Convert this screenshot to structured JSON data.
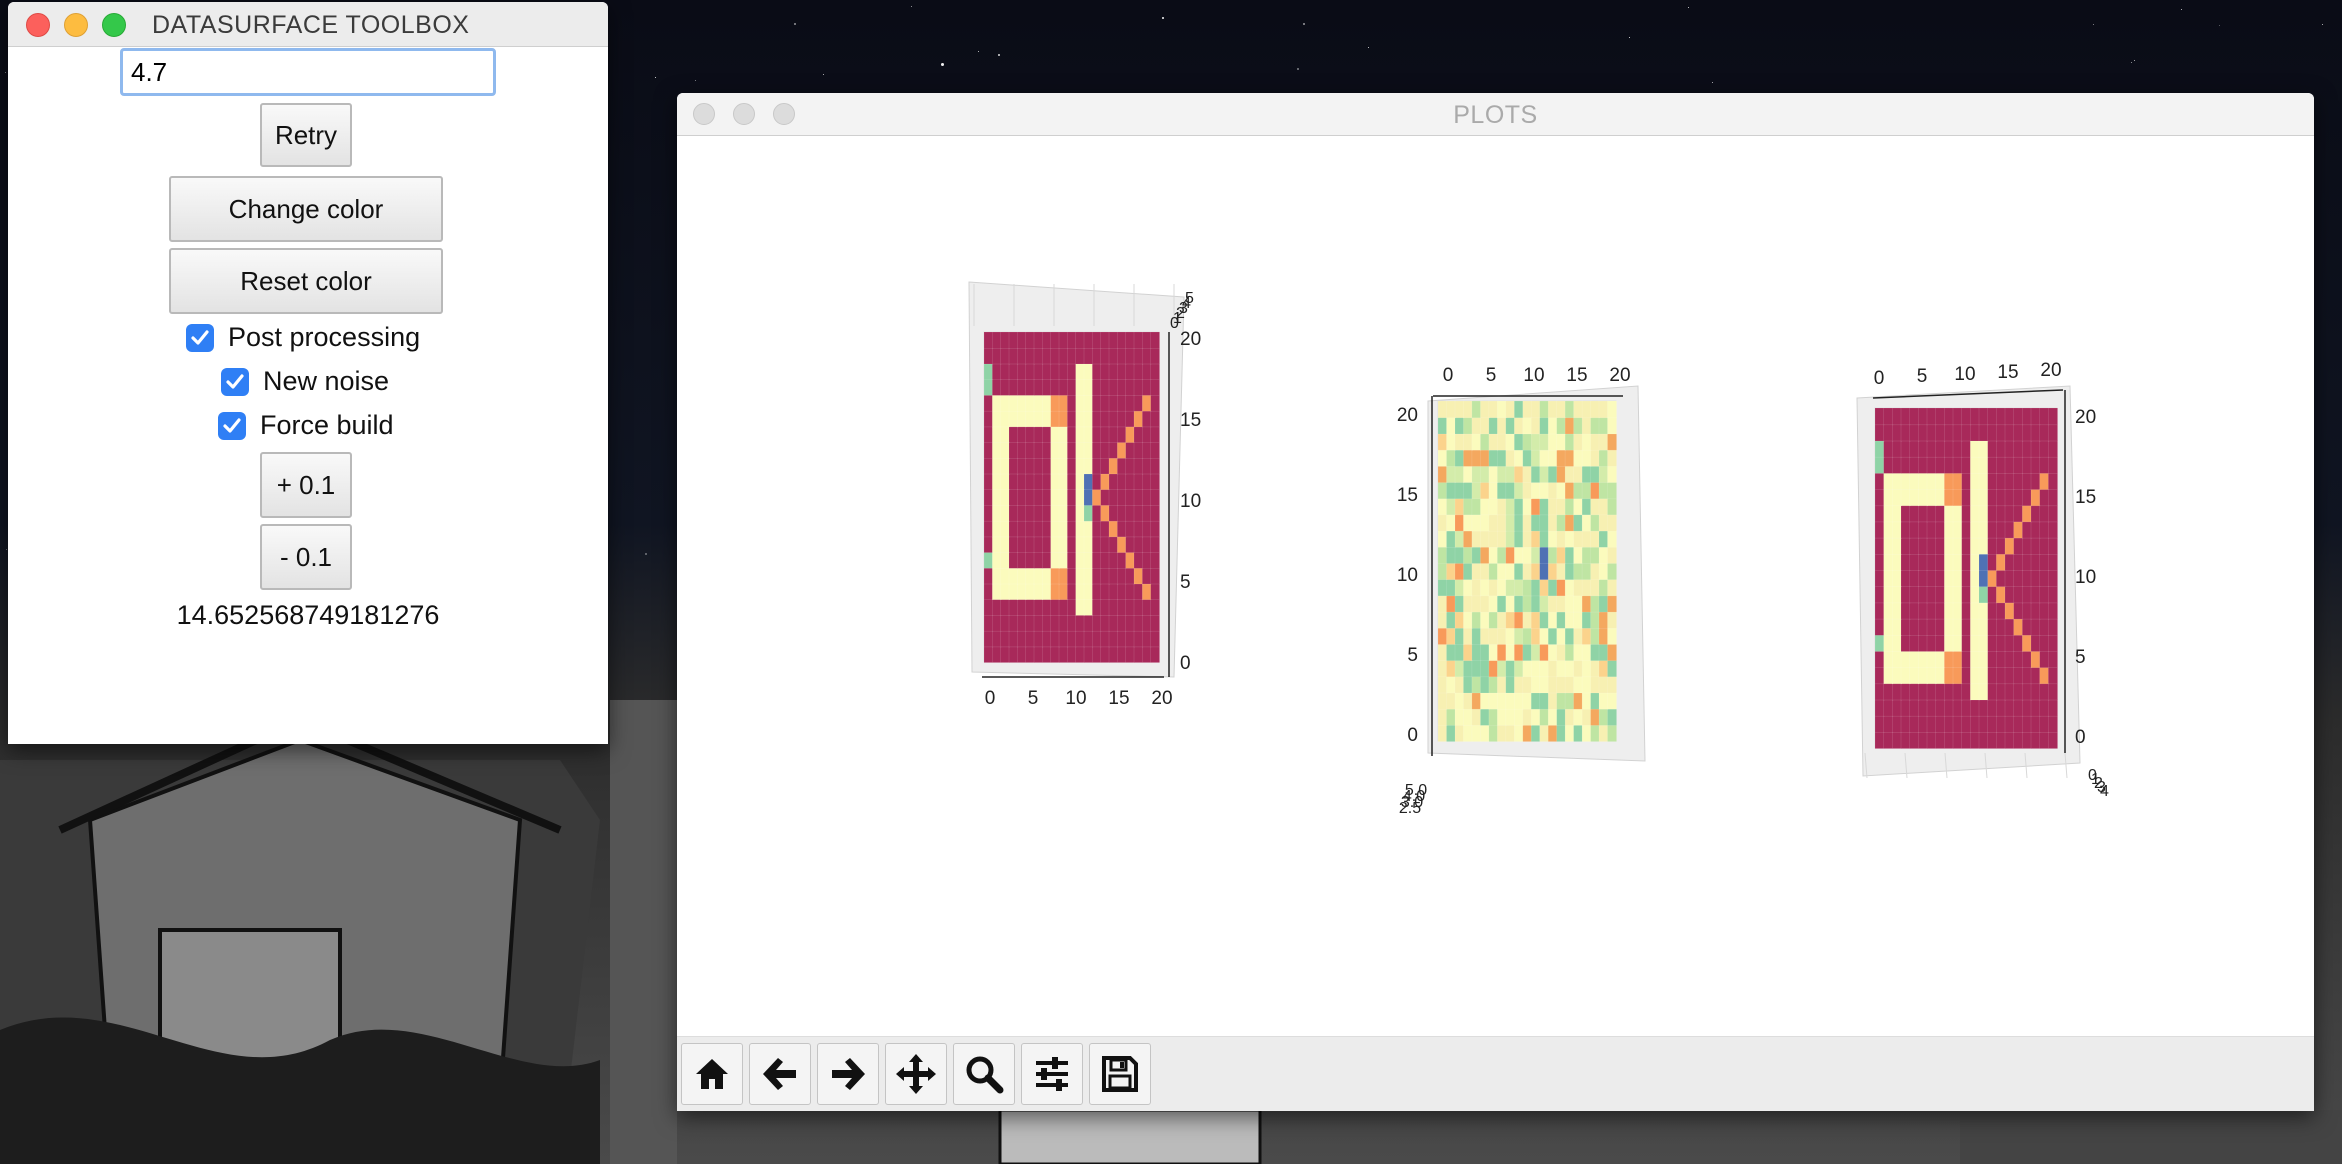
{
  "toolbox": {
    "title": "DATASURFACE TOOLBOX",
    "input_value": "4.7",
    "retry_label": "Retry",
    "change_color_label": "Change color",
    "reset_color_label": "Reset color",
    "post_processing_label": "Post processing",
    "post_processing_checked": true,
    "new_noise_label": "New noise",
    "new_noise_checked": true,
    "force_build_label": "Force build",
    "force_build_checked": true,
    "plus_label": "+ 0.1",
    "minus_label": "- 0.1",
    "readout": "14.652568749181276"
  },
  "plots_window": {
    "title": "PLOTS",
    "toolbar": [
      {
        "icon": "home-icon",
        "action": "home"
      },
      {
        "icon": "arrow-left-icon",
        "action": "back"
      },
      {
        "icon": "arrow-right-icon",
        "action": "forward"
      },
      {
        "icon": "move-icon",
        "action": "pan"
      },
      {
        "icon": "magnifier-icon",
        "action": "zoom"
      },
      {
        "icon": "sliders-icon",
        "action": "configure-subplots"
      },
      {
        "icon": "save-icon",
        "action": "save"
      }
    ]
  },
  "colors": {
    "crimson": "#a8295a",
    "cream": "#fbfbbd",
    "orange": "#f89a5a",
    "mint": "#8fd3a6",
    "blue": "#4f71b4",
    "checkbox_blue": "#2f7ff5"
  },
  "chart_data": [
    {
      "type": "heatmap",
      "name_hint": "3D surface, view 1",
      "x_ticks": [
        "0",
        "5",
        "10",
        "15",
        "20"
      ],
      "y_ticks": [
        "0",
        "5",
        "10",
        "15",
        "20"
      ],
      "z_ticks": [
        "0",
        "1",
        "2",
        "3",
        "4",
        "5"
      ],
      "colormap": "Spectral"
    },
    {
      "type": "heatmap",
      "name_hint": "3D surface with noise, top view",
      "x_ticks": [
        "0",
        "5",
        "10",
        "15",
        "20"
      ],
      "y_ticks": [
        "0",
        "5",
        "10",
        "15",
        "20"
      ],
      "z_ticks": [
        "2.5",
        "3.0",
        "4.0",
        "5.0"
      ],
      "colormap": "Spectral"
    },
    {
      "type": "heatmap",
      "name_hint": "3D surface, view 3",
      "x_ticks": [
        "0",
        "5",
        "10",
        "15",
        "20"
      ],
      "y_ticks": [
        "0",
        "5",
        "10",
        "15",
        "20"
      ],
      "z_ticks": [
        "0",
        "1",
        "2",
        "3",
        "4"
      ],
      "colormap": "Spectral"
    }
  ]
}
